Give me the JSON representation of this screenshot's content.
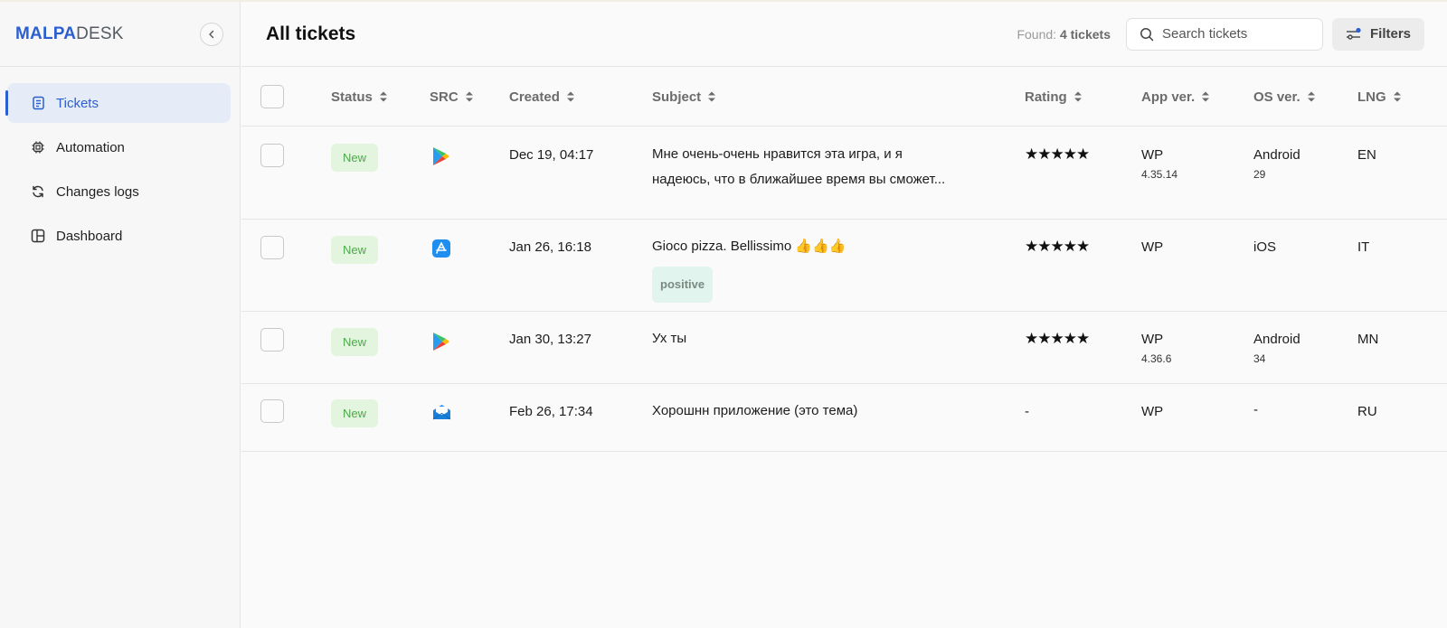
{
  "sidebar": {
    "logo_part1": "MALPA",
    "logo_part2": "DESK",
    "nav": [
      {
        "label": "Tickets",
        "icon": "document-icon",
        "active": true
      },
      {
        "label": "Automation",
        "icon": "chip-icon",
        "active": false
      },
      {
        "label": "Changes logs",
        "icon": "refresh-icon",
        "active": false
      },
      {
        "label": "Dashboard",
        "icon": "dashboard-icon",
        "active": false
      }
    ]
  },
  "header": {
    "title": "All tickets",
    "found_label": "Found:",
    "found_value": "4 tickets",
    "search_placeholder": "Search tickets",
    "filters_label": "Filters"
  },
  "table": {
    "columns": [
      "Status",
      "SRC",
      "Created",
      "Subject",
      "Rating",
      "App ver.",
      "OS ver.",
      "LNG"
    ],
    "rows": [
      {
        "status": "New",
        "src": "google-play-icon",
        "created": "Dec 19, 04:17",
        "subject_line1": "Мне очень-очень нравится эта игра, и я",
        "subject_line2": "надеюсь, что в ближайшее время вы сможет...",
        "tag": "",
        "rating": "★★★★★",
        "app": "WP",
        "app_ver": "4.35.14",
        "os": "Android",
        "os_ver": "29",
        "lng": "EN"
      },
      {
        "status": "New",
        "src": "app-store-icon",
        "created": "Jan 26, 16:18",
        "subject_line1": "Gioco pizza. Bellissimo 👍👍👍",
        "subject_line2": "",
        "tag": "positive",
        "rating": "★★★★★",
        "app": "WP",
        "app_ver": "",
        "os": "iOS",
        "os_ver": "",
        "lng": "IT"
      },
      {
        "status": "New",
        "src": "google-play-icon",
        "created": "Jan 30, 13:27",
        "subject_line1": "Ух ты",
        "subject_line2": "",
        "tag": "",
        "rating": "★★★★★",
        "app": "WP",
        "app_ver": "4.36.6",
        "os": "Android",
        "os_ver": "34",
        "lng": "MN"
      },
      {
        "status": "New",
        "src": "email-icon",
        "created": "Feb 26, 17:34",
        "subject_line1": "Хорошнн приложение (это тема)",
        "subject_line2": "",
        "tag": "",
        "rating": "-",
        "app": "WP",
        "app_ver": "",
        "os": "-",
        "os_ver": "",
        "lng": "RU"
      }
    ]
  },
  "colors": {
    "accent": "#2b5fcf",
    "status_new_bg": "#e3f5df",
    "status_new_text": "#4da94a",
    "tag_bg": "#e2f4ee"
  }
}
